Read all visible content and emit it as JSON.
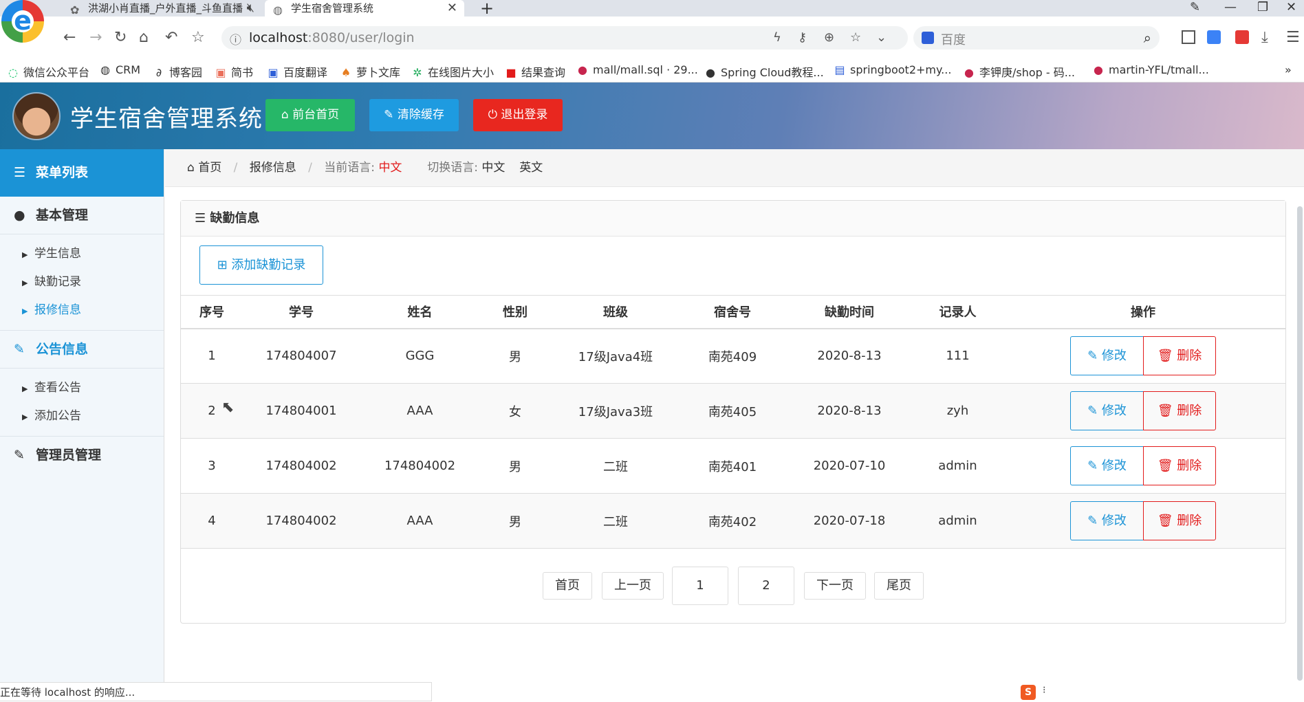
{
  "browser": {
    "tabs": [
      {
        "title": "洪湖小肖直播_户外直播_斗鱼直播"
      },
      {
        "title": "学生宿舍管理系统"
      }
    ],
    "url_host": "localhost",
    "url_rest": ":8080/user/login",
    "search_placeholder": "百度",
    "bookmarks": [
      "微信公众平台",
      "CRM",
      "博客园",
      "简书",
      "百度翻译",
      "萝卜文库",
      "在线图片大小",
      "结果查询",
      "mall/mall.sql · 29...",
      "Spring Cloud教程...",
      "springboot2+my...",
      "李钾庚/shop - 码...",
      "martin-YFL/tmall..."
    ],
    "status_text": "正在等待 localhost 的响应..."
  },
  "header": {
    "title": "学生宿舍管理系统",
    "btn_front": "前台首页",
    "btn_cache": "清除缓存",
    "btn_logout": "退出登录"
  },
  "sidebar": {
    "heading": "菜单列表",
    "groups": [
      {
        "label": "基本管理",
        "items": [
          "学生信息",
          "缺勤记录",
          "报修信息"
        ]
      },
      {
        "label": "公告信息",
        "items": [
          "查看公告",
          "添加公告"
        ]
      },
      {
        "label": "管理员管理",
        "items": []
      }
    ]
  },
  "breadcrumb": {
    "home": "首页",
    "current": "报修信息",
    "lang_label": "当前语言:",
    "lang_value": "中文",
    "switch_label": "切换语言:",
    "lang_zh": "中文",
    "lang_en": "英文"
  },
  "panel": {
    "title": "缺勤信息",
    "add_button": "添加缺勤记录",
    "columns": [
      "序号",
      "学号",
      "姓名",
      "性别",
      "班级",
      "宿舍号",
      "缺勤时间",
      "记录人",
      "操作"
    ],
    "rows": [
      [
        "1",
        "174804007",
        "GGG",
        "男",
        "17级Java4班",
        "南苑409",
        "2020-8-13",
        "111"
      ],
      [
        "2",
        "174804001",
        "AAA",
        "女",
        "17级Java3班",
        "南苑405",
        "2020-8-13",
        "zyh"
      ],
      [
        "3",
        "174804002",
        "174804002",
        "男",
        "二班",
        "南苑401",
        "2020-07-10",
        "admin"
      ],
      [
        "4",
        "174804002",
        "AAA",
        "男",
        "二班",
        "南苑402",
        "2020-07-18",
        "admin"
      ]
    ],
    "edit_label": "修改",
    "delete_label": "删除",
    "pager": {
      "first": "首页",
      "prev": "上一页",
      "pages": [
        "1",
        "2"
      ],
      "next": "下一页",
      "last": "尾页"
    }
  }
}
